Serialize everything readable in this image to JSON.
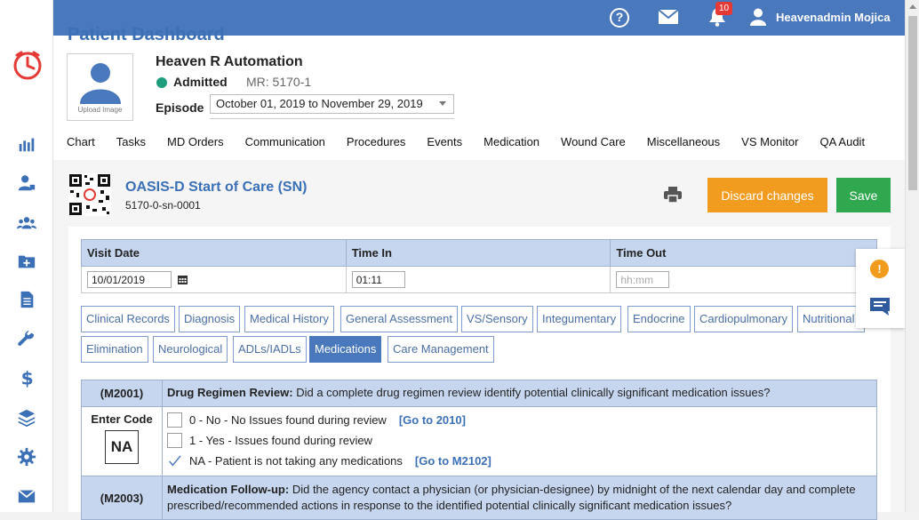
{
  "topbar": {
    "notification_count": "10",
    "user_name": "Heavenadmin Mojica"
  },
  "header": {
    "page_title": "Patient Dashboard",
    "photo_label": "Upload Image",
    "patient_name": "Heaven R Automation",
    "status": "Admitted",
    "mr": "MR: 5170-1",
    "episode_label": "Episode",
    "episode_value": "October 01, 2019 to November 29, 2019",
    "tabs": [
      "Chart",
      "Tasks",
      "MD Orders",
      "Communication",
      "Procedures",
      "Events",
      "Medication",
      "Wound Care",
      "Miscellaneous",
      "VS Monitor",
      "QA Audit"
    ]
  },
  "form": {
    "title": "OASIS-D Start of Care (SN)",
    "code": "5170-0-sn-0001",
    "discard_label": "Discard changes",
    "save_label": "Save"
  },
  "visit": {
    "headers": [
      "Visit Date",
      "Time In",
      "Time Out"
    ],
    "visit_date": "10/01/2019",
    "time_in": "01:11",
    "time_out_placeholder": "hh:mm"
  },
  "section_tabs": {
    "row1": [
      "Clinical Records",
      "Diagnosis",
      "Medical History",
      "General Assessment",
      "VS/Sensory",
      "Integumentary",
      "Endocrine",
      "Cardiopulmonary",
      "Nutritional"
    ],
    "row2": [
      "Elimination",
      "Neurological",
      "ADLs/IADLs",
      "Medications",
      "Care Management"
    ],
    "active": "Medications"
  },
  "m2001": {
    "code": "(M2001)",
    "question_title": "Drug Regimen Review:",
    "question_text": " Did a complete drug regimen review identify potential clinically significant medication issues?",
    "enter_code_label": "Enter Code",
    "entered_code": "NA",
    "options": [
      {
        "label": "0 - No - No Issues found during review",
        "goto": "[Go to 2010]",
        "checked": false
      },
      {
        "label": "1 - Yes - Issues found during review",
        "goto": "",
        "checked": false
      },
      {
        "label": "NA - Patient is not taking any medications",
        "goto": "[Go to M2102]",
        "checked": true
      }
    ]
  },
  "m2003": {
    "code": "(M2003)",
    "question_title": "Medication Follow-up:",
    "question_text": " Did the agency contact a physician (or physician-designee) by midnight of the next calendar day and complete prescribed/recommended actions in response to the identified potential clinically significant medication issues?"
  },
  "colors": {
    "primary": "#4a78bd",
    "discard": "#f29c1f",
    "save": "#2fa84f",
    "status_admitted": "#1e9e7e"
  }
}
